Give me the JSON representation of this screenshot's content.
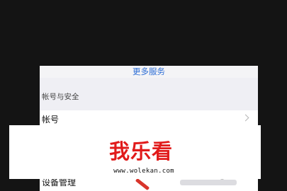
{
  "settings": {
    "more_services": "更多服务",
    "section_title": "帐号与安全",
    "account_label": "帐号",
    "devices_label": "设备管理"
  },
  "watermark": {
    "logo_text": "我乐看",
    "url": "www.wolekan.com"
  },
  "colors": {
    "background": "#141414",
    "link": "#2f6fd6",
    "logo": "#e11b1b"
  }
}
